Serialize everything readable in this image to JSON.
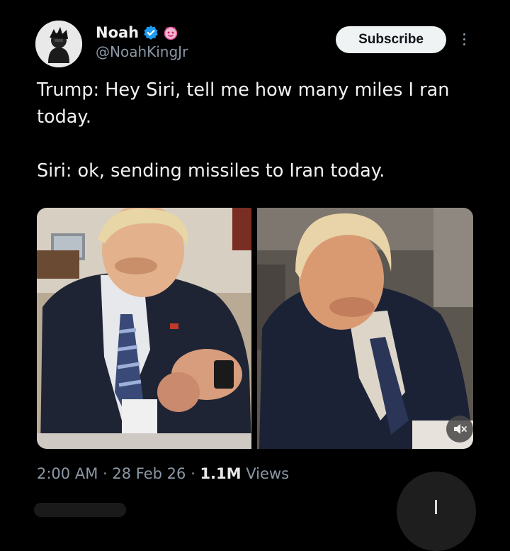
{
  "author": {
    "name": "Noah",
    "handle": "@NoahKingJr",
    "badges": [
      "verified-check-icon",
      "pink-emoji-icon"
    ]
  },
  "actions": {
    "subscribe_label": "Subscribe",
    "more_icon": "more-vertical-icon"
  },
  "tweet": {
    "line1": "Trump: Hey Siri, tell me how many miles I ran today.",
    "line2": "Siri: ok, sending missiles to Iran today."
  },
  "media": {
    "mute_icon": "muted-speaker-icon"
  },
  "meta": {
    "time": "2:00 AM",
    "separator": "·",
    "date": "28 Feb 26",
    "views_count": "1.1M",
    "views_label": "Views"
  },
  "colors": {
    "background": "#000000",
    "verified": "#1d9bf0",
    "secondary_text": "#8b98a5",
    "button_bg": "#eff3f4"
  }
}
